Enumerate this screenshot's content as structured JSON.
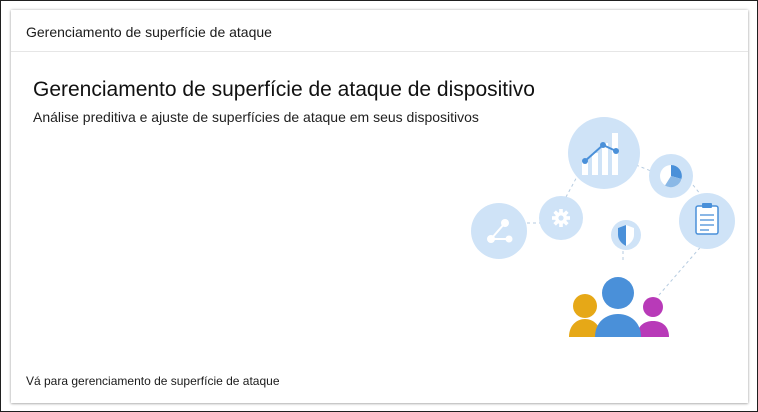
{
  "card": {
    "header_title": "Gerenciamento de superfície de ataque",
    "hero_title": "Gerenciamento de superfície de ataque de dispositivo",
    "hero_subtitle": "Análise preditiva e ajuste de superfícies de ataque em seus dispositivos",
    "footer_link": "Vá para gerenciamento de superfície de ataque"
  },
  "illustration": {
    "icons": [
      "chart-icon",
      "pie-chart-icon",
      "settings-gear-icon",
      "share-network-icon",
      "clipboard-report-icon",
      "shield-icon",
      "people-group-icon"
    ]
  },
  "colors": {
    "bubble_fill": "#cfe3f7",
    "bubble_inner": "#b9d6f2",
    "accent_blue": "#4a90d9",
    "person_yellow": "#e6a817",
    "person_purple": "#b83ab8"
  }
}
